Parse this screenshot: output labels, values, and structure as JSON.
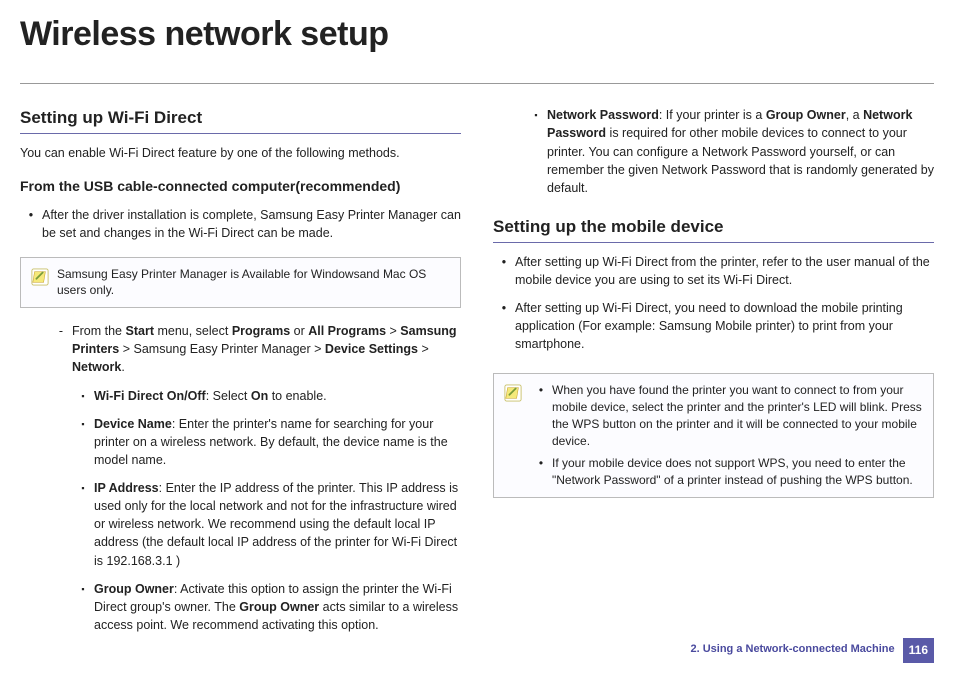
{
  "title": "Wireless network setup",
  "left": {
    "h2": "Setting up Wi-Fi Direct",
    "intro": "You can enable Wi-Fi Direct feature by one of the following methods.",
    "h3": "From the USB cable-connected computer(recommended)",
    "bullet1": "After the driver installation is complete, Samsung Easy Printer Manager can be set and changes in the Wi-Fi Direct can be made.",
    "note": "Samsung Easy Printer Manager is Available for Windowsand Mac OS users only.",
    "nav_a": "From the ",
    "nav_b": " menu, select ",
    "nav_c": " or ",
    "nav_d": " > ",
    "nav_e": " > Samsung Easy Printer Manager > ",
    "nav_f": " > ",
    "nav_g": ".",
    "nav_start": "Start",
    "nav_programs": "Programs",
    "nav_allprograms": "All Programs",
    "nav_sp": "Samsung Printers",
    "nav_ds": "Device Settings",
    "nav_network": "Network",
    "sub1_a": "Wi-Fi Direct On/Off",
    "sub1_b": ": Select ",
    "sub1_c": "On",
    "sub1_d": " to enable.",
    "sub2_a": "Device Name",
    "sub2_b": ": Enter the printer's name for searching for your printer on a wireless network. By default, the device name is the model name.",
    "sub3_a": "IP Address",
    "sub3_b": ": Enter the IP address of the printer. This IP address is used only for the local network and not for the infrastructure wired or wireless network. We recommend using the default local IP address (the default local IP address of the printer for Wi-Fi Direct is 192.168.3.1 )",
    "sub4_a": "Group Owner",
    "sub4_b": ": Activate this option to assign the printer the Wi-Fi Direct group's owner. The ",
    "sub4_c": "Group Owner",
    "sub4_d": " acts similar to a wireless access point. We recommend activating this option."
  },
  "right": {
    "top_a": "Network Password",
    "top_b": ": If your printer is a ",
    "top_c": "Group Owner",
    "top_d": ", a ",
    "top_e": "Network Password",
    "top_f": " is required for other mobile devices to connect to your printer. You can configure a Network Password yourself, or can remember the given Network Password that is randomly generated by default.",
    "h2": "Setting up the mobile device",
    "b1": "After setting up Wi-Fi Direct from the printer, refer to the user manual of the mobile device you are using to set its Wi-Fi Direct.",
    "b2": "After setting up Wi-Fi Direct, you need to download the mobile printing application (For example: Samsung Mobile printer) to print from your smartphone.",
    "note1": "When you have found the printer you want to connect to from your mobile device, select the printer and the printer's LED will blink. Press the WPS button on the printer and it will be connected to your mobile device.",
    "note2": "If your mobile device does not support WPS, you need to enter the \"Network Password\" of a printer instead of pushing the WPS button."
  },
  "footer": {
    "chapter": "2.  Using a Network-connected Machine",
    "page": "116"
  }
}
